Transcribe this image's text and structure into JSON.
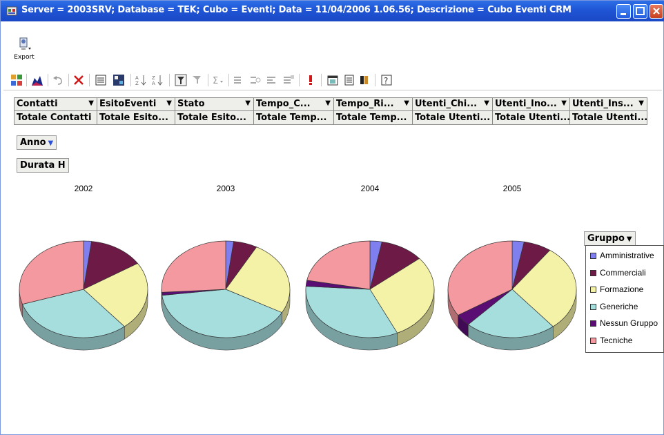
{
  "window": {
    "title": "Server = 2003SRV; Database = TEK; Cubo = Eventi; Data = 11/04/2006 1.06.56; Descrizione = Cubo Eventi CRM"
  },
  "export": {
    "label": "Export"
  },
  "fields": {
    "headers": [
      "Contatti",
      "EsitoEventi",
      "Stato",
      "Tempo_C...",
      "Tempo_Ri...",
      "Utenti_Chi...",
      "Utenti_Ino...",
      "Utenti_Ins..."
    ],
    "totals": [
      "Totale Contatti",
      "Totale Esito...",
      "Totale Esito...",
      "Totale Temp...",
      "Totale Temp...",
      "Totale Utenti...",
      "Totale Utenti...",
      "Totale Utenti..."
    ]
  },
  "filters": {
    "anno": "Anno",
    "durata": "Durata H",
    "gruppo": "Gruppo"
  },
  "colors": {
    "Amministrative": "#7f7ff0",
    "Commerciali": "#6e1a47",
    "Formazione": "#f4f2a6",
    "Generiche": "#a6dede",
    "Nessun Gruppo": "#5a0e74",
    "Tecniche": "#f4999f"
  },
  "chart_data": {
    "type": "pie",
    "series_names": [
      "Amministrative",
      "Commerciali",
      "Formazione",
      "Generiche",
      "Nessun Gruppo",
      "Tecniche"
    ],
    "pies": [
      {
        "label": "2002",
        "values": [
          2,
          14,
          23,
          31,
          0,
          30
        ]
      },
      {
        "label": "2003",
        "values": [
          2,
          6,
          25,
          40,
          1,
          26
        ]
      },
      {
        "label": "2004",
        "values": [
          3,
          11,
          29,
          33,
          2,
          22
        ]
      },
      {
        "label": "2005",
        "values": [
          3,
          7,
          29,
          23,
          4,
          34
        ]
      }
    ],
    "legend_placement": "right"
  }
}
